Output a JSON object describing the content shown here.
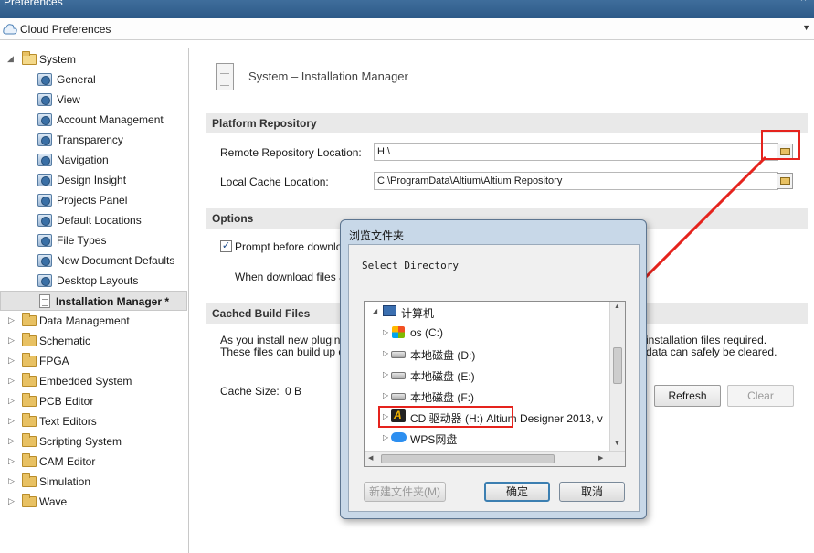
{
  "window": {
    "title": "Preferences",
    "close_glyph": "×"
  },
  "cloud": {
    "label": "Cloud Preferences",
    "dropdown_glyph": "▼"
  },
  "tree": {
    "system": "System",
    "system_children": [
      "General",
      "View",
      "Account Management",
      "Transparency",
      "Navigation",
      "Design Insight",
      "Projects Panel",
      "Default Locations",
      "File Types",
      "New Document Defaults",
      "Desktop Layouts"
    ],
    "selected": "Installation Manager *",
    "groups": [
      "Data Management",
      "Schematic",
      "FPGA",
      "Embedded System",
      "PCB Editor",
      "Text Editors",
      "Scripting System",
      "CAM Editor",
      "Simulation",
      "Wave"
    ]
  },
  "content": {
    "title": "System – Installation Manager",
    "platform": {
      "header": "Platform Repository",
      "remote_label": "Remote Repository Location:",
      "remote_value": "H:\\",
      "local_label": "Local Cache Location:",
      "local_value": "C:\\ProgramData\\Altium\\Altium Repository"
    },
    "options": {
      "header": "Options",
      "prompt_label": "Prompt before downlo",
      "prompt_checked": "✓",
      "when_label": "When download files a"
    },
    "cached": {
      "header": "Cached Build Files",
      "line1_left": "As you install new plugins",
      "line1_right": "installation files required.",
      "line2_left": "These files can build up o",
      "line2_right": "data can safely be cleared.",
      "cache_size_label": "Cache Size:",
      "cache_size_value": "0 B",
      "refresh": "Refresh",
      "clear": "Clear"
    }
  },
  "dialog": {
    "title": "浏览文件夹",
    "prompt": "Select Directory",
    "items": [
      {
        "label": "计算机",
        "arrow": "◢",
        "icon": "computer-icon"
      },
      {
        "label": "os (C:)",
        "arrow": "▷",
        "icon": "windows-drive-icon"
      },
      {
        "label": "本地磁盘 (D:)",
        "arrow": "▷",
        "icon": "hard-drive-icon"
      },
      {
        "label": "本地磁盘 (E:)",
        "arrow": "▷",
        "icon": "hard-drive-icon"
      },
      {
        "label": "本地磁盘 (F:)",
        "arrow": "▷",
        "icon": "hard-drive-icon"
      },
      {
        "label": "CD 驱动器 (H:) Altium Designer 2013, v",
        "arrow": "▷",
        "icon": "cd-drive-icon"
      },
      {
        "label": "WPS网盘",
        "arrow": "▷",
        "icon": "wps-cloud-icon"
      }
    ],
    "new_folder": "新建文件夹(M)",
    "ok": "确定",
    "cancel": "取消"
  },
  "colors": {
    "annotation": "#e5231d",
    "header_bg": "#e9e9e9",
    "dialog_frame": "#c8d8e8"
  }
}
